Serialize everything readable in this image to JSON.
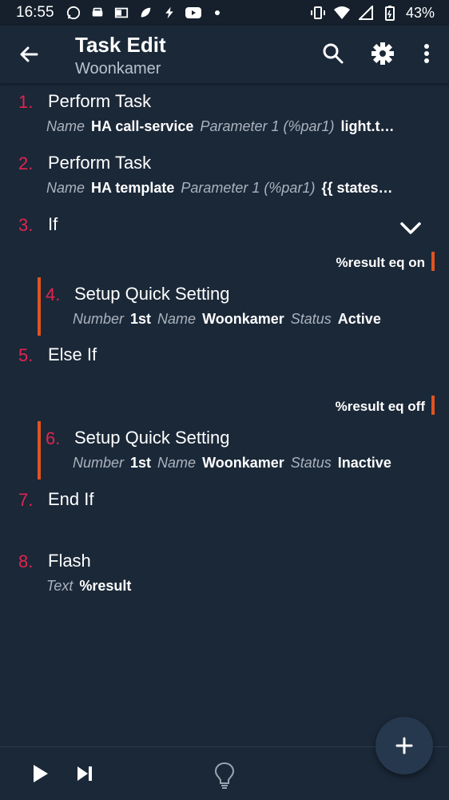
{
  "status_bar": {
    "time": "16:55",
    "battery": "43%",
    "left_icons": [
      "whatsapp-icon",
      "car-icon",
      "outlook-icon",
      "leaf-icon",
      "bolt-icon",
      "youtube-icon",
      "dot-icon"
    ],
    "right_icons": [
      "vibrate-icon",
      "wifi-icon",
      "signal-icon",
      "battery-icon"
    ]
  },
  "app_bar": {
    "title": "Task Edit",
    "subtitle": "Woonkamer"
  },
  "actions": [
    {
      "number": "1.",
      "name": "Perform Task",
      "params": [
        [
          "Name",
          "HA call-service"
        ],
        [
          "Parameter 1 (%par1)",
          "light.t…"
        ]
      ]
    },
    {
      "number": "2.",
      "name": "Perform Task",
      "params": [
        [
          "Name",
          "HA template"
        ],
        [
          "Parameter 1 (%par1)",
          "{{ states…"
        ]
      ]
    },
    {
      "number": "3.",
      "name": "If",
      "condition": "%result eq on"
    },
    {
      "number": "4.",
      "name": "Setup Quick Setting",
      "params": [
        [
          "Number",
          "1st"
        ],
        [
          "Name",
          "Woonkamer"
        ],
        [
          "Status",
          "Active"
        ]
      ]
    },
    {
      "number": "5.",
      "name": "Else If",
      "condition": "%result eq off"
    },
    {
      "number": "6.",
      "name": "Setup Quick Setting",
      "params": [
        [
          "Number",
          "1st"
        ],
        [
          "Name",
          "Woonkamer"
        ],
        [
          "Status",
          "Inactive"
        ]
      ]
    },
    {
      "number": "7.",
      "name": "End If"
    },
    {
      "number": "8.",
      "name": "Flash",
      "params": [
        [
          "Text",
          "%result"
        ]
      ]
    }
  ],
  "colors": {
    "background": "#1b2838",
    "number": "#e0254f",
    "accent_bar": "#e05420",
    "param_key": "#aab3bd"
  }
}
